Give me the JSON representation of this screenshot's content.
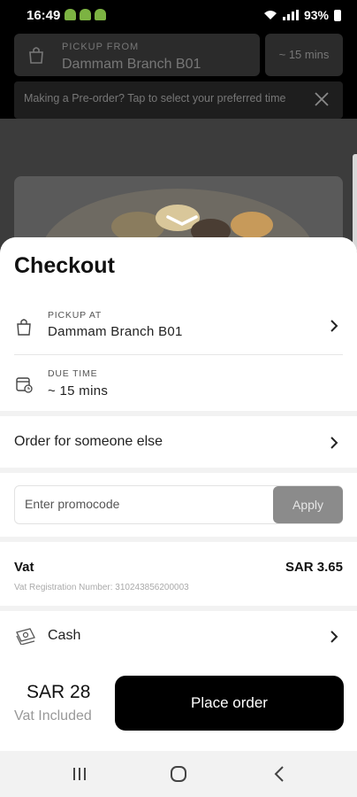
{
  "status_bar": {
    "time": "16:49",
    "battery": "93%"
  },
  "background": {
    "pickup_caption": "PICKUP FROM",
    "pickup_branch": "Dammam Branch B01",
    "time_estimate": "~ 15 mins",
    "preorder_message": "Making a Pre-order? Tap to select your preferred time"
  },
  "checkout": {
    "title": "Checkout",
    "pickup_caption": "PICKUP AT",
    "pickup_branch": "Dammam Branch B01",
    "due_caption": "DUE TIME",
    "due_value": "~ 15 mins",
    "order_for_someone": "Order for someone else",
    "promo_placeholder": "Enter promocode",
    "apply_label": "Apply",
    "vat_label": "Vat",
    "vat_amount": "SAR 3.65",
    "vat_registration": "Vat Registration Number:   310243856200003",
    "payment_method": "Cash"
  },
  "footer": {
    "total": "SAR 28",
    "vat_included": "Vat Included",
    "place_order_label": "Place order"
  },
  "icons": [
    "android-icon",
    "wifi-icon",
    "signal-icon",
    "battery-icon",
    "shopping-bag-icon",
    "close-icon",
    "chevron-down-icon",
    "calendar-clock-icon",
    "chevron-right-icon",
    "cash-icon",
    "recents-icon",
    "home-icon",
    "back-icon"
  ]
}
